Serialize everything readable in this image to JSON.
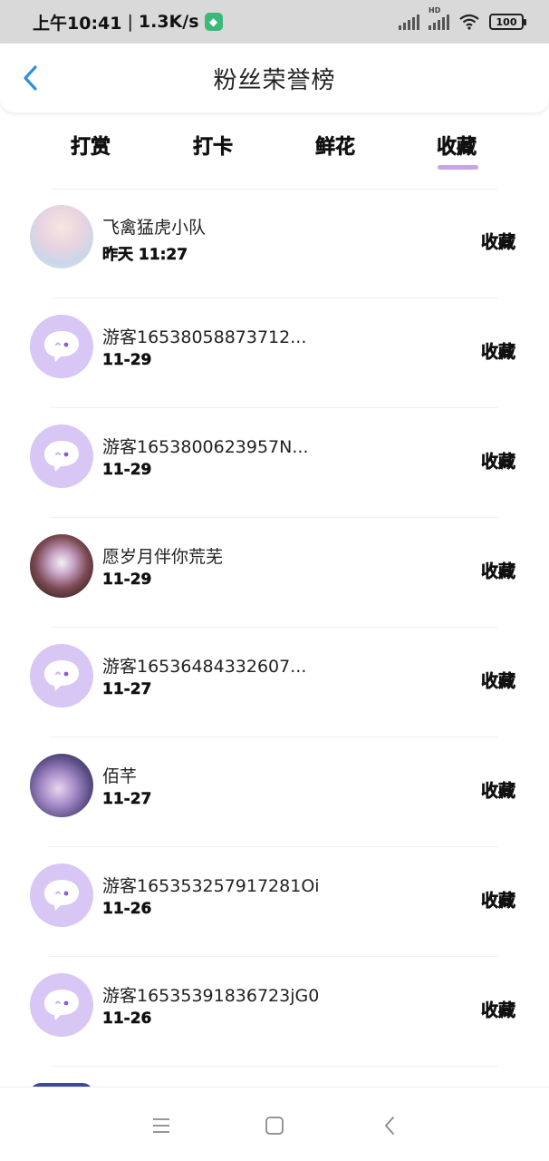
{
  "status_bar": {
    "time": "上午10:41",
    "speed": "1.3K/s",
    "network_label": "HD",
    "battery": "100"
  },
  "header": {
    "title": "粉丝荣誉榜"
  },
  "tabs": [
    {
      "label": "打赏"
    },
    {
      "label": "打卡"
    },
    {
      "label": "鲜花"
    },
    {
      "label": "收藏"
    }
  ],
  "active_tab": "收藏",
  "list": [
    {
      "name": "飞禽猛虎小队",
      "time": "昨天 11:27",
      "action": "收藏",
      "avatar": "photo"
    },
    {
      "name": "游客16538058873712...",
      "time": "11-29",
      "action": "收藏",
      "avatar": "default"
    },
    {
      "name": "游客1653800623957N...",
      "time": "11-29",
      "action": "收藏",
      "avatar": "default"
    },
    {
      "name": "愿岁月伴你荒芜",
      "time": "11-29",
      "action": "收藏",
      "avatar": "photo"
    },
    {
      "name": "游客16536484332607...",
      "time": "11-27",
      "action": "收藏",
      "avatar": "default"
    },
    {
      "name": "佰芊",
      "time": "11-27",
      "action": "收藏",
      "avatar": "photo"
    },
    {
      "name": "游客165353257917281Oi",
      "time": "11-26",
      "action": "收藏",
      "avatar": "default"
    },
    {
      "name": "游客16535391836723jG0",
      "time": "11-26",
      "action": "收藏",
      "avatar": "default"
    }
  ],
  "colors": {
    "accent": "#c9a4e6",
    "back_arrow": "#2f8fe0",
    "default_avatar": "#d8c6f5"
  }
}
